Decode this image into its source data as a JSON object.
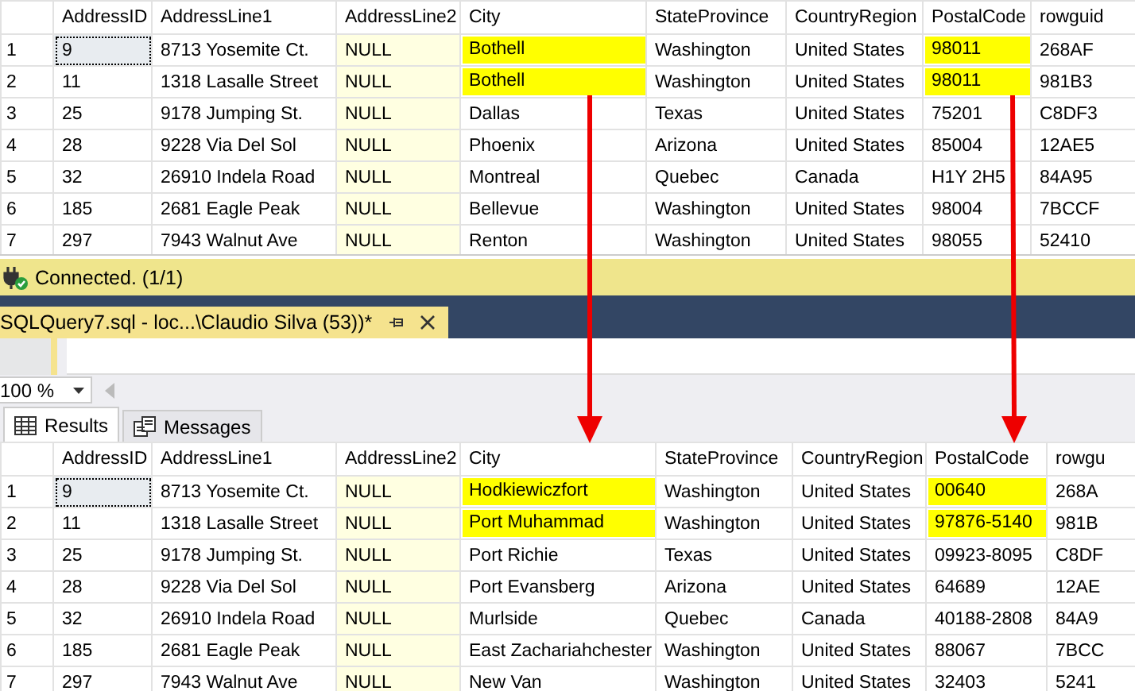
{
  "grids": [
    {
      "columns": [
        {
          "label": "AddressID",
          "kind": "text"
        },
        {
          "label": "AddressLine1",
          "kind": "text"
        },
        {
          "label": "AddressLine2",
          "kind": "null"
        },
        {
          "label": "City",
          "kind": "text"
        },
        {
          "label": "StateProvince",
          "kind": "text"
        },
        {
          "label": "CountryRegion",
          "kind": "text"
        },
        {
          "label": "PostalCode",
          "kind": "text"
        },
        {
          "label": "rowguid",
          "kind": "text"
        }
      ],
      "rows": [
        {
          "number": "1",
          "cells": [
            {
              "text": "9",
              "current": true,
              "highlighted": false
            },
            {
              "text": "8713 Yosemite Ct.",
              "current": false,
              "highlighted": false
            },
            {
              "text": "NULL",
              "current": false,
              "highlighted": false
            },
            {
              "text": "Bothell",
              "current": false,
              "highlighted": true
            },
            {
              "text": "Washington",
              "current": false,
              "highlighted": false
            },
            {
              "text": "United States",
              "current": false,
              "highlighted": false
            },
            {
              "text": "98011",
              "current": false,
              "highlighted": true
            },
            {
              "text": "268AF",
              "current": false,
              "highlighted": false
            }
          ]
        },
        {
          "number": "2",
          "cells": [
            {
              "text": "11",
              "current": false,
              "highlighted": false
            },
            {
              "text": "1318 Lasalle Street",
              "current": false,
              "highlighted": false
            },
            {
              "text": "NULL",
              "current": false,
              "highlighted": false
            },
            {
              "text": "Bothell",
              "current": false,
              "highlighted": true
            },
            {
              "text": "Washington",
              "current": false,
              "highlighted": false
            },
            {
              "text": "United States",
              "current": false,
              "highlighted": false
            },
            {
              "text": "98011",
              "current": false,
              "highlighted": true
            },
            {
              "text": "981B3",
              "current": false,
              "highlighted": false
            }
          ]
        },
        {
          "number": "3",
          "cells": [
            {
              "text": "25",
              "current": false,
              "highlighted": false
            },
            {
              "text": "9178 Jumping St.",
              "current": false,
              "highlighted": false
            },
            {
              "text": "NULL",
              "current": false,
              "highlighted": false
            },
            {
              "text": "Dallas",
              "current": false,
              "highlighted": false
            },
            {
              "text": "Texas",
              "current": false,
              "highlighted": false
            },
            {
              "text": "United States",
              "current": false,
              "highlighted": false
            },
            {
              "text": "75201",
              "current": false,
              "highlighted": false
            },
            {
              "text": "C8DF3",
              "current": false,
              "highlighted": false
            }
          ]
        },
        {
          "number": "4",
          "cells": [
            {
              "text": "28",
              "current": false,
              "highlighted": false
            },
            {
              "text": "9228 Via Del Sol",
              "current": false,
              "highlighted": false
            },
            {
              "text": "NULL",
              "current": false,
              "highlighted": false
            },
            {
              "text": "Phoenix",
              "current": false,
              "highlighted": false
            },
            {
              "text": "Arizona",
              "current": false,
              "highlighted": false
            },
            {
              "text": "United States",
              "current": false,
              "highlighted": false
            },
            {
              "text": "85004",
              "current": false,
              "highlighted": false
            },
            {
              "text": "12AE5",
              "current": false,
              "highlighted": false
            }
          ]
        },
        {
          "number": "5",
          "cells": [
            {
              "text": "32",
              "current": false,
              "highlighted": false
            },
            {
              "text": "26910 Indela Road",
              "current": false,
              "highlighted": false
            },
            {
              "text": "NULL",
              "current": false,
              "highlighted": false
            },
            {
              "text": "Montreal",
              "current": false,
              "highlighted": false
            },
            {
              "text": "Quebec",
              "current": false,
              "highlighted": false
            },
            {
              "text": "Canada",
              "current": false,
              "highlighted": false
            },
            {
              "text": "H1Y 2H5",
              "current": false,
              "highlighted": false
            },
            {
              "text": "84A95",
              "current": false,
              "highlighted": false
            }
          ]
        },
        {
          "number": "6",
          "cells": [
            {
              "text": "185",
              "current": false,
              "highlighted": false
            },
            {
              "text": "2681 Eagle Peak",
              "current": false,
              "highlighted": false
            },
            {
              "text": "NULL",
              "current": false,
              "highlighted": false
            },
            {
              "text": "Bellevue",
              "current": false,
              "highlighted": false
            },
            {
              "text": "Washington",
              "current": false,
              "highlighted": false
            },
            {
              "text": "United States",
              "current": false,
              "highlighted": false
            },
            {
              "text": "98004",
              "current": false,
              "highlighted": false
            },
            {
              "text": "7BCCF",
              "current": false,
              "highlighted": false
            }
          ]
        },
        {
          "number": "7",
          "cells": [
            {
              "text": "297",
              "current": false,
              "highlighted": false
            },
            {
              "text": "7943 Walnut Ave",
              "current": false,
              "highlighted": false
            },
            {
              "text": "NULL",
              "current": false,
              "highlighted": false
            },
            {
              "text": "Renton",
              "current": false,
              "highlighted": false
            },
            {
              "text": "Washington",
              "current": false,
              "highlighted": false
            },
            {
              "text": "United States",
              "current": false,
              "highlighted": false
            },
            {
              "text": "98055",
              "current": false,
              "highlighted": false
            },
            {
              "text": "52410",
              "current": false,
              "highlighted": false
            }
          ]
        }
      ]
    },
    {
      "columns": [
        {
          "label": "AddressID",
          "kind": "text"
        },
        {
          "label": "AddressLine1",
          "kind": "text"
        },
        {
          "label": "AddressLine2",
          "kind": "null"
        },
        {
          "label": "City",
          "kind": "text"
        },
        {
          "label": "StateProvince",
          "kind": "text"
        },
        {
          "label": "CountryRegion",
          "kind": "text"
        },
        {
          "label": "PostalCode",
          "kind": "text"
        },
        {
          "label": "rowgu",
          "kind": "text"
        }
      ],
      "rows": [
        {
          "number": "1",
          "cells": [
            {
              "text": "9",
              "current": true,
              "highlighted": false
            },
            {
              "text": "8713 Yosemite Ct.",
              "current": false,
              "highlighted": false
            },
            {
              "text": "NULL",
              "current": false,
              "highlighted": false
            },
            {
              "text": "Hodkiewiczfort",
              "current": false,
              "highlighted": true
            },
            {
              "text": "Washington",
              "current": false,
              "highlighted": false
            },
            {
              "text": "United States",
              "current": false,
              "highlighted": false
            },
            {
              "text": "00640",
              "current": false,
              "highlighted": true
            },
            {
              "text": "268A",
              "current": false,
              "highlighted": false
            }
          ]
        },
        {
          "number": "2",
          "cells": [
            {
              "text": "11",
              "current": false,
              "highlighted": false
            },
            {
              "text": "1318 Lasalle Street",
              "current": false,
              "highlighted": false
            },
            {
              "text": "NULL",
              "current": false,
              "highlighted": false
            },
            {
              "text": "Port Muhammad",
              "current": false,
              "highlighted": true
            },
            {
              "text": "Washington",
              "current": false,
              "highlighted": false
            },
            {
              "text": "United States",
              "current": false,
              "highlighted": false
            },
            {
              "text": "97876-5140",
              "current": false,
              "highlighted": true
            },
            {
              "text": "981B",
              "current": false,
              "highlighted": false
            }
          ]
        },
        {
          "number": "3",
          "cells": [
            {
              "text": "25",
              "current": false,
              "highlighted": false
            },
            {
              "text": "9178 Jumping St.",
              "current": false,
              "highlighted": false
            },
            {
              "text": "NULL",
              "current": false,
              "highlighted": false
            },
            {
              "text": "Port Richie",
              "current": false,
              "highlighted": false
            },
            {
              "text": "Texas",
              "current": false,
              "highlighted": false
            },
            {
              "text": "United States",
              "current": false,
              "highlighted": false
            },
            {
              "text": "09923-8095",
              "current": false,
              "highlighted": false
            },
            {
              "text": "C8DF",
              "current": false,
              "highlighted": false
            }
          ]
        },
        {
          "number": "4",
          "cells": [
            {
              "text": "28",
              "current": false,
              "highlighted": false
            },
            {
              "text": "9228 Via Del Sol",
              "current": false,
              "highlighted": false
            },
            {
              "text": "NULL",
              "current": false,
              "highlighted": false
            },
            {
              "text": "Port Evansberg",
              "current": false,
              "highlighted": false
            },
            {
              "text": "Arizona",
              "current": false,
              "highlighted": false
            },
            {
              "text": "United States",
              "current": false,
              "highlighted": false
            },
            {
              "text": "64689",
              "current": false,
              "highlighted": false
            },
            {
              "text": "12AE",
              "current": false,
              "highlighted": false
            }
          ]
        },
        {
          "number": "5",
          "cells": [
            {
              "text": "32",
              "current": false,
              "highlighted": false
            },
            {
              "text": "26910 Indela Road",
              "current": false,
              "highlighted": false
            },
            {
              "text": "NULL",
              "current": false,
              "highlighted": false
            },
            {
              "text": "Murlside",
              "current": false,
              "highlighted": false
            },
            {
              "text": "Quebec",
              "current": false,
              "highlighted": false
            },
            {
              "text": "Canada",
              "current": false,
              "highlighted": false
            },
            {
              "text": "40188-2808",
              "current": false,
              "highlighted": false
            },
            {
              "text": "84A9",
              "current": false,
              "highlighted": false
            }
          ]
        },
        {
          "number": "6",
          "cells": [
            {
              "text": "185",
              "current": false,
              "highlighted": false
            },
            {
              "text": "2681 Eagle Peak",
              "current": false,
              "highlighted": false
            },
            {
              "text": "NULL",
              "current": false,
              "highlighted": false
            },
            {
              "text": "East Zachariahchester",
              "current": false,
              "highlighted": false
            },
            {
              "text": "Washington",
              "current": false,
              "highlighted": false
            },
            {
              "text": "United States",
              "current": false,
              "highlighted": false
            },
            {
              "text": "88067",
              "current": false,
              "highlighted": false
            },
            {
              "text": "7BCC",
              "current": false,
              "highlighted": false
            }
          ]
        },
        {
          "number": "7",
          "cells": [
            {
              "text": "297",
              "current": false,
              "highlighted": false
            },
            {
              "text": "7943 Walnut Ave",
              "current": false,
              "highlighted": false
            },
            {
              "text": "NULL",
              "current": false,
              "highlighted": false
            },
            {
              "text": "New Van",
              "current": false,
              "highlighted": false
            },
            {
              "text": "Washington",
              "current": false,
              "highlighted": false
            },
            {
              "text": "United States",
              "current": false,
              "highlighted": false
            },
            {
              "text": "32403",
              "current": false,
              "highlighted": false
            },
            {
              "text": "5241",
              "current": false,
              "highlighted": false
            }
          ]
        }
      ]
    }
  ],
  "status_bar": {
    "text": "Connected. (1/1)"
  },
  "document_tab": {
    "title": "SQLQuery7.sql - loc...\\Claudio Silva (53))*",
    "selected": true
  },
  "zoom": {
    "value": "100 %"
  },
  "result_tabs": [
    {
      "label": "Results",
      "selected": true
    },
    {
      "label": "Messages",
      "selected": false
    }
  ]
}
